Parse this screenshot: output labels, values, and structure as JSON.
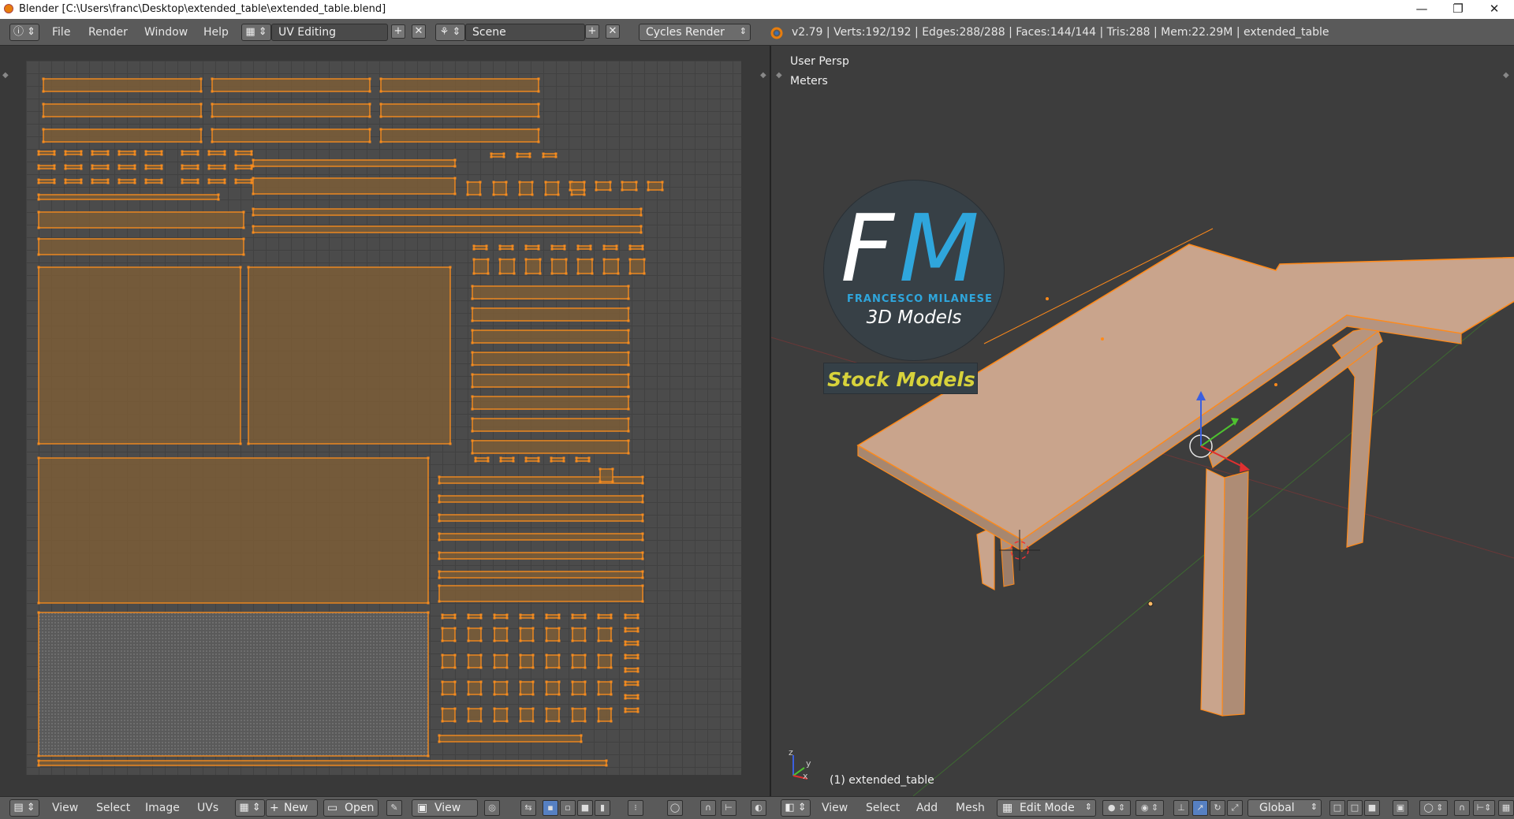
{
  "window": {
    "title": "Blender [C:\\Users\\franc\\Desktop\\extended_table\\extended_table.blend]",
    "minimize": "—",
    "restore": "❐",
    "close": "✕"
  },
  "header": {
    "menu": [
      "File",
      "Render",
      "Window",
      "Help"
    ],
    "screen_layout": "UV Editing",
    "scene": "Scene",
    "render_engine": "Cycles Render",
    "stats": "v2.79 | Verts:192/192 | Edges:288/288 | Faces:144/144 | Tris:288 | Mem:22.29M | extended_table"
  },
  "viewport": {
    "view_label": "User Persp",
    "units_label": "Meters",
    "object_label": "(1) extended_table",
    "axis_labels": {
      "x": "x",
      "y": "y",
      "z": "z"
    }
  },
  "logo": {
    "letter_f": "F",
    "letter_m": "M",
    "name": "FRANCESCO MILANESE",
    "subtitle": "3D Models",
    "banner": "Stock Models",
    "colors": {
      "circle": "#374046",
      "accent": "#2fa6dc",
      "banner_text": "#d7d23b"
    }
  },
  "uv_footer": {
    "menu": [
      "View",
      "Select",
      "Image",
      "UVs"
    ],
    "new_label": "New",
    "open_label": "Open",
    "view_label": "View"
  },
  "view3d_footer": {
    "menu": [
      "View",
      "Select",
      "Add",
      "Mesh"
    ],
    "mode": "Edit Mode",
    "orientation": "Global"
  },
  "colors": {
    "uv_fill": "#7b5d37",
    "uv_edge": "#f58b1e",
    "mesh_face": "#c9a48c",
    "selection": "#ff8a1a"
  }
}
